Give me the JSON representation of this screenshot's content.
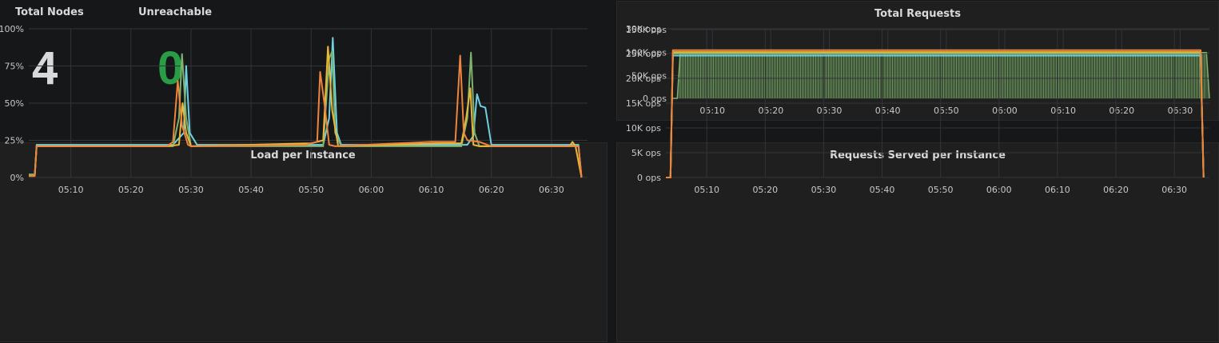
{
  "stats": {
    "total_nodes": {
      "title": "Total Nodes",
      "value": "4",
      "color": "#d8d9da"
    },
    "unreachable": {
      "title": "Unreachable",
      "value": "0",
      "color": "#299c46"
    }
  },
  "panels": {
    "total_requests": {
      "title": "Total Requests"
    },
    "load": {
      "title": "Load per Instance"
    },
    "served": {
      "title": "Requests Served per Instance"
    }
  },
  "chart_data": [
    {
      "id": "total_requests",
      "type": "area",
      "title": "Total Requests",
      "x_ticks": [
        "05:10",
        "05:20",
        "05:30",
        "05:40",
        "05:50",
        "06:00",
        "06:10",
        "06:20",
        "06:30"
      ],
      "xlim_minutes": [
        "05:03",
        "06:35"
      ],
      "y_ticks": [
        "0 ops",
        "50K ops",
        "100K ops",
        "150K ops"
      ],
      "ylim": [
        0,
        150000
      ],
      "grid": true,
      "series": [
        {
          "color": "#7eb26d",
          "points": [
            [
              "05:03",
              0
            ],
            [
              "05:04",
              0
            ],
            [
              "05:04.5",
              100000
            ],
            [
              "06:34.5",
              100000
            ],
            [
              "06:35",
              0
            ]
          ]
        }
      ]
    },
    {
      "id": "load",
      "type": "line",
      "title": "Load per Instance",
      "x_ticks": [
        "05:10",
        "05:20",
        "05:30",
        "05:40",
        "05:50",
        "06:00",
        "06:10",
        "06:20",
        "06:30"
      ],
      "xlim_minutes": [
        "05:03",
        "06:36"
      ],
      "y_ticks": [
        "0%",
        "25%",
        "50%",
        "75%",
        "100%"
      ],
      "ylim": [
        0,
        100
      ],
      "grid": true,
      "series": [
        {
          "color": "#6ed0e0",
          "points": [
            [
              "05:03",
              2
            ],
            [
              "05:04",
              2
            ],
            [
              "05:04.3",
              22
            ],
            [
              "05:27",
              22
            ],
            [
              "05:28.8",
              30
            ],
            [
              "05:29.2",
              75
            ],
            [
              "05:29.8",
              30
            ],
            [
              "05:31",
              22
            ],
            [
              "05:52",
              22
            ],
            [
              "05:53",
              40
            ],
            [
              "05:53.6",
              94
            ],
            [
              "05:54.3",
              30
            ],
            [
              "05:55",
              22
            ],
            [
              "06:16",
              22
            ],
            [
              "06:17",
              28
            ],
            [
              "06:17.6",
              56
            ],
            [
              "06:18.2",
              48
            ],
            [
              "06:19",
              47
            ],
            [
              "06:20",
              22
            ],
            [
              "06:34.5",
              22
            ],
            [
              "06:35",
              0
            ]
          ]
        },
        {
          "color": "#7eb26d",
          "points": [
            [
              "05:03",
              2
            ],
            [
              "05:04",
              2
            ],
            [
              "05:04.3",
              21
            ],
            [
              "05:27",
              21
            ],
            [
              "05:28",
              40
            ],
            [
              "05:28.5",
              83
            ],
            [
              "05:29.2",
              40
            ],
            [
              "05:30",
              21
            ],
            [
              "05:52",
              21
            ],
            [
              "05:53",
              80
            ],
            [
              "05:53.5",
              85
            ],
            [
              "05:54",
              30
            ],
            [
              "05:55",
              21
            ],
            [
              "06:15",
              21
            ],
            [
              "06:16",
              40
            ],
            [
              "06:16.6",
              84
            ],
            [
              "06:17.2",
              30
            ],
            [
              "06:18",
              21
            ],
            [
              "06:34.5",
              21
            ],
            [
              "06:35",
              0
            ]
          ]
        },
        {
          "color": "#eab839",
          "points": [
            [
              "05:03",
              1
            ],
            [
              "05:04",
              1
            ],
            [
              "05:04.3",
              21
            ],
            [
              "05:26",
              21
            ],
            [
              "05:28",
              22
            ],
            [
              "05:28.6",
              50
            ],
            [
              "05:29.2",
              30
            ],
            [
              "05:30",
              21
            ],
            [
              "05:50",
              23
            ],
            [
              "05:52",
              25
            ],
            [
              "05:52.8",
              88
            ],
            [
              "05:53.5",
              45
            ],
            [
              "05:54.5",
              21
            ],
            [
              "06:12",
              23
            ],
            [
              "06:15",
              23
            ],
            [
              "06:15.8",
              40
            ],
            [
              "06:16.5",
              60
            ],
            [
              "06:17",
              22
            ],
            [
              "06:18",
              21
            ],
            [
              "06:33",
              21
            ],
            [
              "06:33.5",
              24
            ],
            [
              "06:34",
              21
            ],
            [
              "06:35",
              0
            ]
          ]
        },
        {
          "color": "#ef843c",
          "points": [
            [
              "05:03",
              1
            ],
            [
              "05:04",
              1
            ],
            [
              "05:04.3",
              21
            ],
            [
              "05:26",
              21
            ],
            [
              "05:27",
              24
            ],
            [
              "05:27.8",
              65
            ],
            [
              "05:28.5",
              35
            ],
            [
              "05:29.5",
              22
            ],
            [
              "05:30",
              21
            ],
            [
              "05:49",
              22
            ],
            [
              "05:51",
              24
            ],
            [
              "05:51.5",
              71
            ],
            [
              "05:52.2",
              50
            ],
            [
              "05:53",
              22
            ],
            [
              "05:54",
              21
            ],
            [
              "06:10",
              24
            ],
            [
              "06:14",
              24
            ],
            [
              "06:14.8",
              82
            ],
            [
              "06:15.4",
              30
            ],
            [
              "06:16",
              25
            ],
            [
              "06:18",
              24
            ],
            [
              "06:20",
              21
            ],
            [
              "06:34.5",
              21
            ],
            [
              "06:35",
              0
            ]
          ]
        }
      ]
    },
    {
      "id": "served",
      "type": "line",
      "title": "Requests Served per Instance",
      "x_ticks": [
        "05:10",
        "05:20",
        "05:30",
        "05:40",
        "05:50",
        "06:00",
        "06:10",
        "06:20",
        "06:30"
      ],
      "xlim_minutes": [
        "05:03",
        "06:36"
      ],
      "y_ticks": [
        "0 ops",
        "5K ops",
        "10K ops",
        "15K ops",
        "20K ops",
        "25K ops",
        "30K ops"
      ],
      "ylim": [
        0,
        30000
      ],
      "grid": true,
      "series": [
        {
          "color": "#6ed0e0",
          "points": [
            [
              "05:03",
              0
            ],
            [
              "05:03.8",
              0
            ],
            [
              "05:04.2",
              24600
            ],
            [
              "06:34.5",
              24600
            ],
            [
              "06:35",
              0
            ]
          ]
        },
        {
          "color": "#7eb26d",
          "points": [
            [
              "05:03",
              0
            ],
            [
              "05:03.8",
              0
            ],
            [
              "05:04.2",
              25000
            ],
            [
              "06:34.5",
              25000
            ],
            [
              "06:35",
              0
            ]
          ]
        },
        {
          "color": "#eab839",
          "points": [
            [
              "05:03",
              0
            ],
            [
              "05:03.8",
              0
            ],
            [
              "05:04.2",
              25300
            ],
            [
              "06:34.5",
              25300
            ],
            [
              "06:35",
              0
            ]
          ]
        },
        {
          "color": "#ef843c",
          "points": [
            [
              "05:03",
              0
            ],
            [
              "05:03.8",
              0
            ],
            [
              "05:04.2",
              25700
            ],
            [
              "06:34.5",
              25700
            ],
            [
              "06:35",
              0
            ]
          ]
        }
      ]
    }
  ]
}
